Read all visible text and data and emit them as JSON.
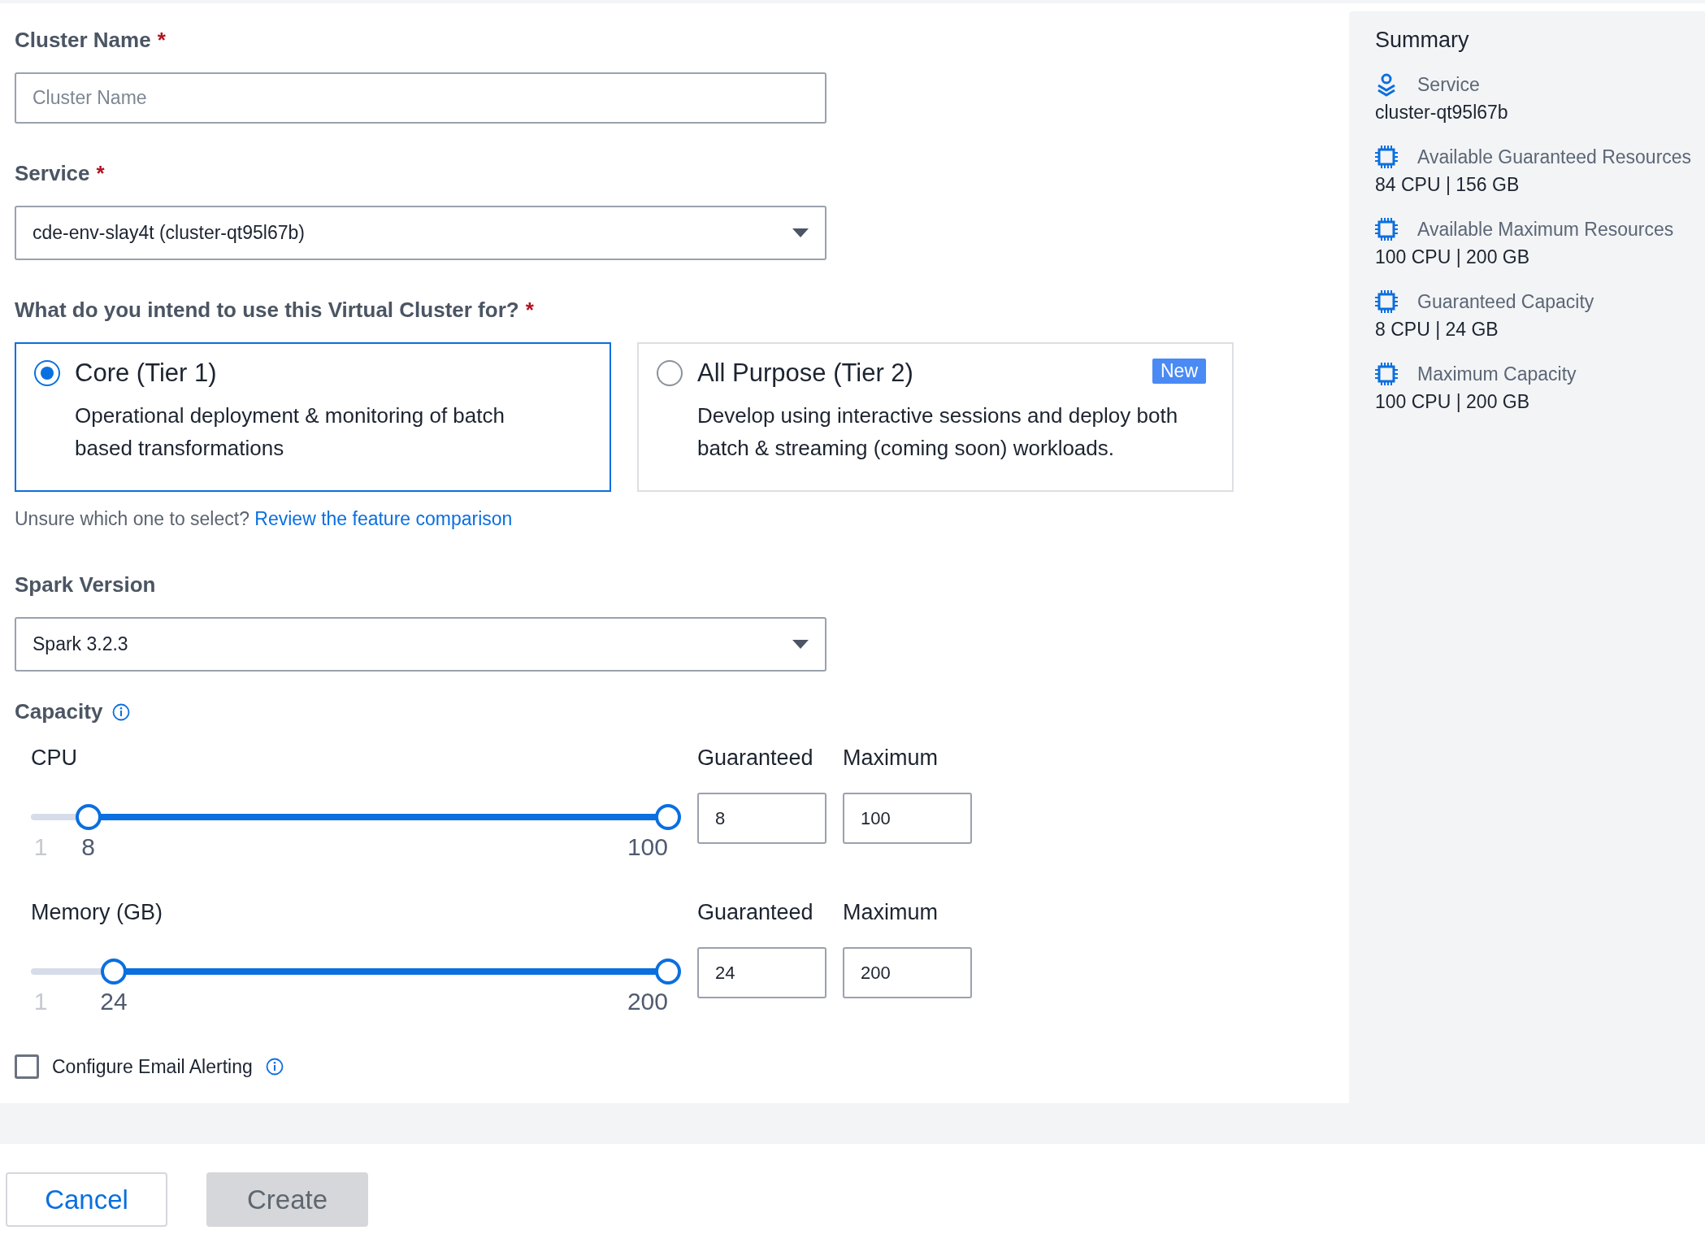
{
  "form": {
    "cluster_name": {
      "label": "Cluster Name",
      "required_mark": "*",
      "placeholder": "Cluster Name"
    },
    "service": {
      "label": "Service",
      "required_mark": "*",
      "value": "cde-env-slay4t (cluster-qt95l67b)"
    },
    "tier": {
      "label": "What do you intend to use this Virtual Cluster for?",
      "required_mark": "*",
      "options": [
        {
          "title": "Core (Tier 1)",
          "description": "Operational deployment & monitoring of batch based transformations",
          "selected": true
        },
        {
          "title": "All Purpose (Tier 2)",
          "description": "Develop using interactive sessions and deploy both batch & streaming (coming soon) workloads.",
          "selected": false,
          "badge": "New"
        }
      ],
      "hint": "Unsure which one to select?",
      "link": "Review the feature comparison"
    },
    "spark_version": {
      "label": "Spark Version",
      "value": "Spark 3.2.3"
    },
    "capacity": {
      "label": "Capacity",
      "resources": [
        {
          "name": "CPU",
          "min_label": "1",
          "low": {
            "level": 0.09,
            "reading": "8"
          },
          "high": {
            "level": 1,
            "reading": "100"
          },
          "guaranteed_label": "Guaranteed",
          "guaranteed": "8",
          "maximum_label": "Maximum",
          "maximum": "100"
        },
        {
          "name": "Memory (GB)",
          "min_label": "1",
          "low": {
            "level": 0.13,
            "reading": "24"
          },
          "high": {
            "level": 1,
            "reading": "200"
          },
          "guaranteed_label": "Guaranteed",
          "guaranteed": "24",
          "maximum_label": "Maximum",
          "maximum": "200"
        }
      ]
    },
    "email_alerting": {
      "label": "Configure Email Alerting",
      "checked": false
    }
  },
  "summary": {
    "title": "Summary",
    "items": [
      {
        "kind": "service",
        "label": "Service",
        "value": "cluster-qt95l67b"
      },
      {
        "kind": "resource",
        "label": "Available Guaranteed Resources",
        "value": "84 CPU | 156 GB"
      },
      {
        "kind": "resource",
        "label": "Available Maximum Resources",
        "value": "100 CPU | 200 GB"
      },
      {
        "kind": "resource",
        "label": "Guaranteed Capacity",
        "value": "8 CPU | 24 GB"
      },
      {
        "kind": "resource",
        "label": "Maximum Capacity",
        "value": "100 CPU | 200 GB"
      }
    ]
  },
  "buttons": [
    {
      "label": "Cancel",
      "disabled": false
    },
    {
      "label": "Create",
      "disabled": true
    }
  ]
}
